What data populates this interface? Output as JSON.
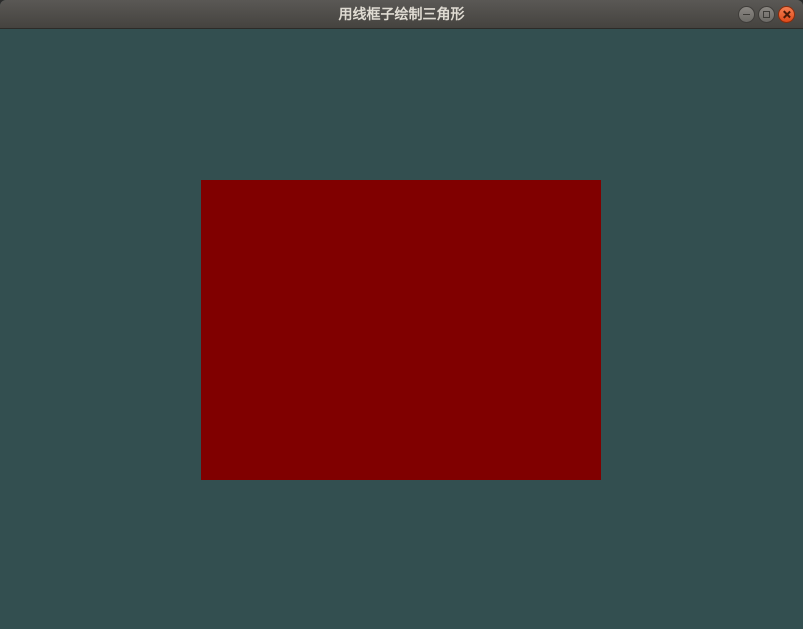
{
  "window": {
    "title": "用线框子绘制三角形"
  },
  "controls": {
    "minimize": "minimize-icon",
    "maximize": "maximize-icon",
    "close": "close-icon"
  },
  "canvas": {
    "background_color": "#334f50",
    "shape_color": "#800000"
  }
}
